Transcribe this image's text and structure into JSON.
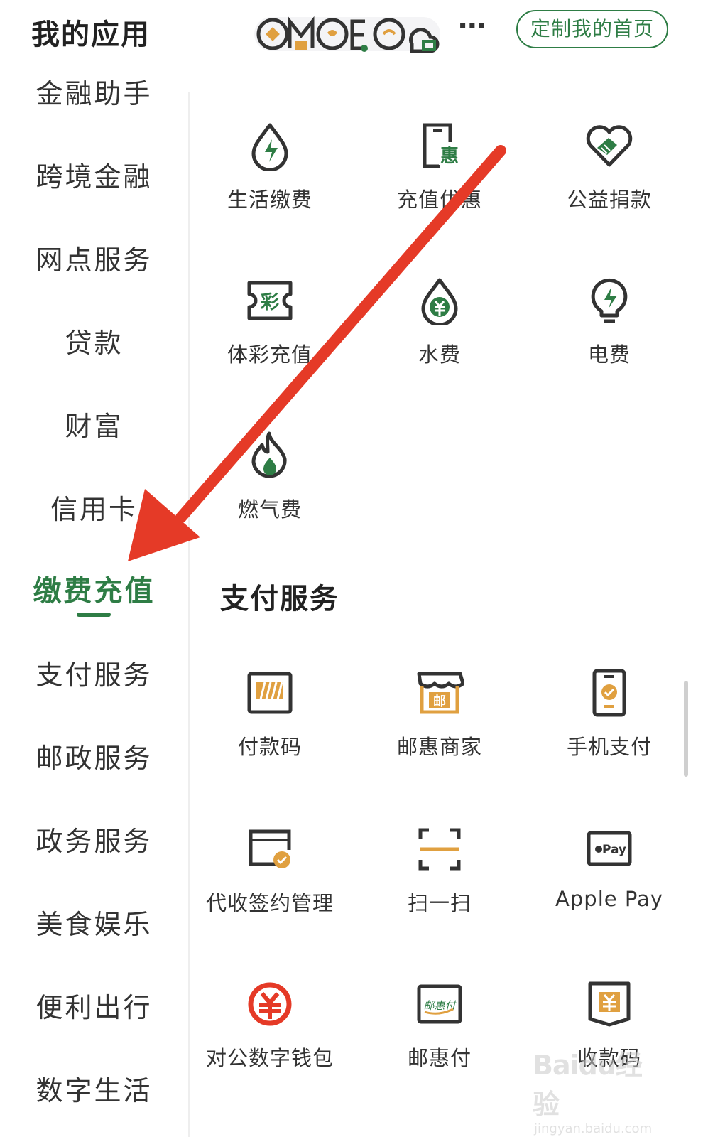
{
  "header": {
    "title": "我的应用",
    "more": "···",
    "customize_label": "定制我的首页"
  },
  "sidebar": {
    "items": [
      {
        "label": "金融助手"
      },
      {
        "label": "跨境金融"
      },
      {
        "label": "网点服务"
      },
      {
        "label": "贷款"
      },
      {
        "label": "财富"
      },
      {
        "label": "信用卡"
      },
      {
        "label": "缴费充值",
        "active": true
      },
      {
        "label": "支付服务"
      },
      {
        "label": "邮政服务"
      },
      {
        "label": "政务服务"
      },
      {
        "label": "美食娱乐"
      },
      {
        "label": "便利出行"
      },
      {
        "label": "数字生活"
      }
    ]
  },
  "recharge": {
    "tiles": [
      {
        "label": "生活缴费",
        "icon": "bolt-drop-icon"
      },
      {
        "label": "充值优惠",
        "icon": "phone-discount-icon"
      },
      {
        "label": "公益捐款",
        "icon": "heart-hand-icon"
      },
      {
        "label": "体彩充值",
        "icon": "lottery-ticket-icon"
      },
      {
        "label": "水费",
        "icon": "water-drop-icon"
      },
      {
        "label": "电费",
        "icon": "lightbulb-icon"
      },
      {
        "label": "燃气费",
        "icon": "flame-icon"
      }
    ]
  },
  "payment": {
    "title": "支付服务",
    "tiles": [
      {
        "label": "付款码",
        "icon": "barcode-icon"
      },
      {
        "label": "邮惠商家",
        "icon": "store-icon",
        "badge": "邮"
      },
      {
        "label": "手机支付",
        "icon": "phone-pay-icon"
      },
      {
        "label": "代收签约管理",
        "icon": "contract-icon"
      },
      {
        "label": "扫一扫",
        "icon": "scan-icon"
      },
      {
        "label": "Apple Pay",
        "icon": "apple-pay-icon",
        "badge": "Pay"
      },
      {
        "label": "对公数字钱包",
        "icon": "yuan-wallet-icon"
      },
      {
        "label": "邮惠付",
        "icon": "card-pay-icon",
        "badge": "邮惠付"
      },
      {
        "label": "收款码",
        "icon": "receive-code-icon"
      }
    ]
  },
  "colors": {
    "brand_green": "#2e7d45",
    "accent_orange": "#e0a040",
    "arrow_red": "#e53a27"
  },
  "watermark": {
    "text": "Baidu经验",
    "sub": "jingyan.baidu.com"
  }
}
